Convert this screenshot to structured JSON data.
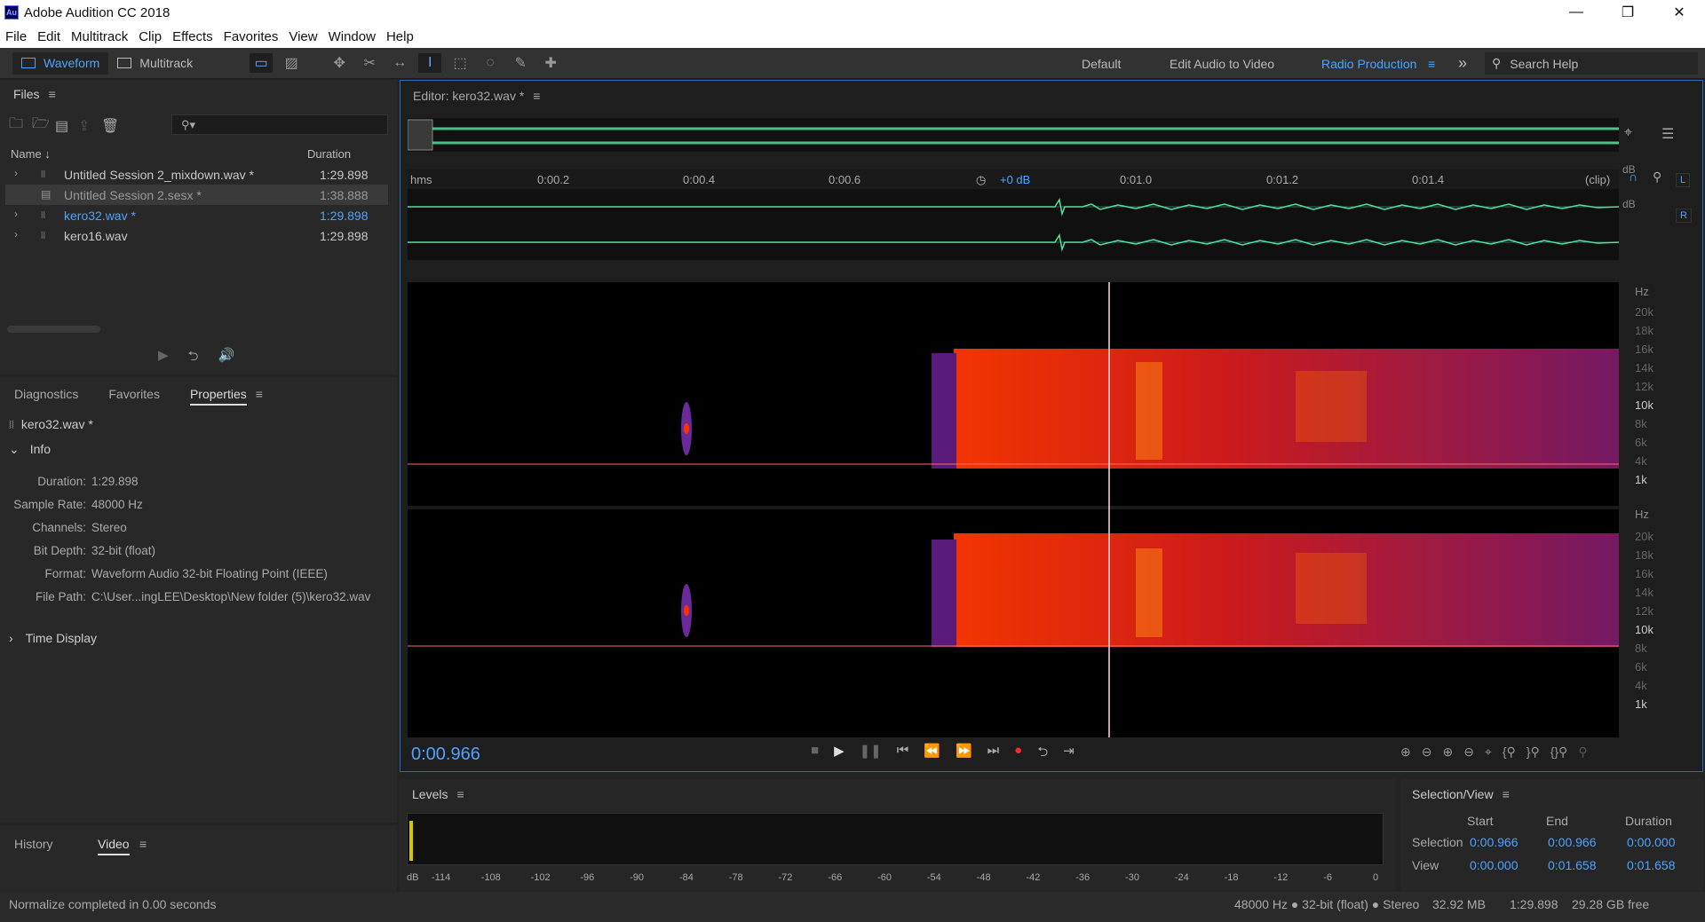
{
  "window": {
    "title": "Adobe Audition CC 2018",
    "logo": "Au",
    "min": "—",
    "max": "❐",
    "close": "✕"
  },
  "menu": [
    "File",
    "Edit",
    "Multitrack",
    "Clip",
    "Effects",
    "Favorites",
    "View",
    "Window",
    "Help"
  ],
  "toolbar": {
    "waveform": "Waveform",
    "multitrack": "Multitrack",
    "workspaces": [
      "Default",
      "Edit Audio to Video",
      "Radio Production"
    ],
    "search_help": "Search Help",
    "more": "»"
  },
  "files": {
    "title": "Files",
    "search_placeholder": "⚲▾",
    "col_name": "Name",
    "col_duration": "Duration",
    "items": [
      {
        "name": "Untitled Session 2_mixdown.wav *",
        "duration": "1:29.898",
        "icon": "waveform-icon",
        "state": "normal"
      },
      {
        "name": "Untitled Session 2.sesx *",
        "duration": "1:38.888",
        "icon": "session-icon",
        "state": "selected"
      },
      {
        "name": "kero32.wav *",
        "duration": "1:29.898",
        "icon": "waveform-icon",
        "state": "active"
      },
      {
        "name": "kero16.wav",
        "duration": "1:29.898",
        "icon": "waveform-icon",
        "state": "normal"
      }
    ]
  },
  "properties": {
    "tabs": [
      "Diagnostics",
      "Favorites",
      "Properties"
    ],
    "active_tab": "Properties",
    "file": "kero32.wav *",
    "info_label": "Info",
    "rows": [
      {
        "key": "Duration:",
        "value": "1:29.898"
      },
      {
        "key": "Sample Rate:",
        "value": "48000 Hz"
      },
      {
        "key": "Channels:",
        "value": "Stereo"
      },
      {
        "key": "Bit Depth:",
        "value": "32-bit (float)"
      },
      {
        "key": "Format:",
        "value": "Waveform Audio 32-bit Floating Point (IEEE)"
      },
      {
        "key": "File Path:",
        "value": "C:\\User...ingLEE\\Desktop\\New folder (5)\\kero32.wav"
      }
    ],
    "time_display": "Time Display"
  },
  "bottom_tabs": [
    "History",
    "Video"
  ],
  "editor": {
    "title": "Editor: kero32.wav *",
    "ruler": {
      "unit": "hms",
      "ticks": [
        "0:00.2",
        "0:00.4",
        "0:00.6",
        "0:01.0",
        "0:01.2",
        "0:01.4"
      ],
      "clip": "(clip)",
      "volume": "+0 dB"
    },
    "channels": [
      "L",
      "R"
    ],
    "db_label": "dB",
    "hz_label": "Hz",
    "hz_ticks": [
      "20k",
      "18k",
      "16k",
      "14k",
      "12k",
      "10k",
      "8k",
      "6k",
      "4k",
      "1k"
    ],
    "timecode": "0:00.966",
    "playhead_time_s": 0.966
  },
  "levels": {
    "title": "Levels",
    "scale": [
      "dB",
      "-114",
      "-108",
      "-102",
      "-96",
      "-90",
      "-84",
      "-78",
      "-72",
      "-66",
      "-60",
      "-54",
      "-48",
      "-42",
      "-36",
      "-30",
      "-24",
      "-18",
      "-12",
      "-6",
      "0"
    ]
  },
  "selection_view": {
    "title": "Selection/View",
    "headers": [
      "Start",
      "End",
      "Duration"
    ],
    "rows": [
      {
        "label": "Selection",
        "start": "0:00.966",
        "end": "0:00.966",
        "duration": "0:00.000"
      },
      {
        "label": "View",
        "start": "0:00.000",
        "end": "0:01.658",
        "duration": "0:01.658"
      }
    ]
  },
  "status": {
    "message": "Normalize completed in 0.00 seconds",
    "format": "48000 Hz ● 32-bit (float) ● Stereo",
    "size": "32.92 MB",
    "duration": "1:29.898",
    "free": "29.28 GB free"
  },
  "colors": {
    "accent": "#4ea3ff",
    "wave": "#52e0a0",
    "playhead": "#ff3333"
  }
}
